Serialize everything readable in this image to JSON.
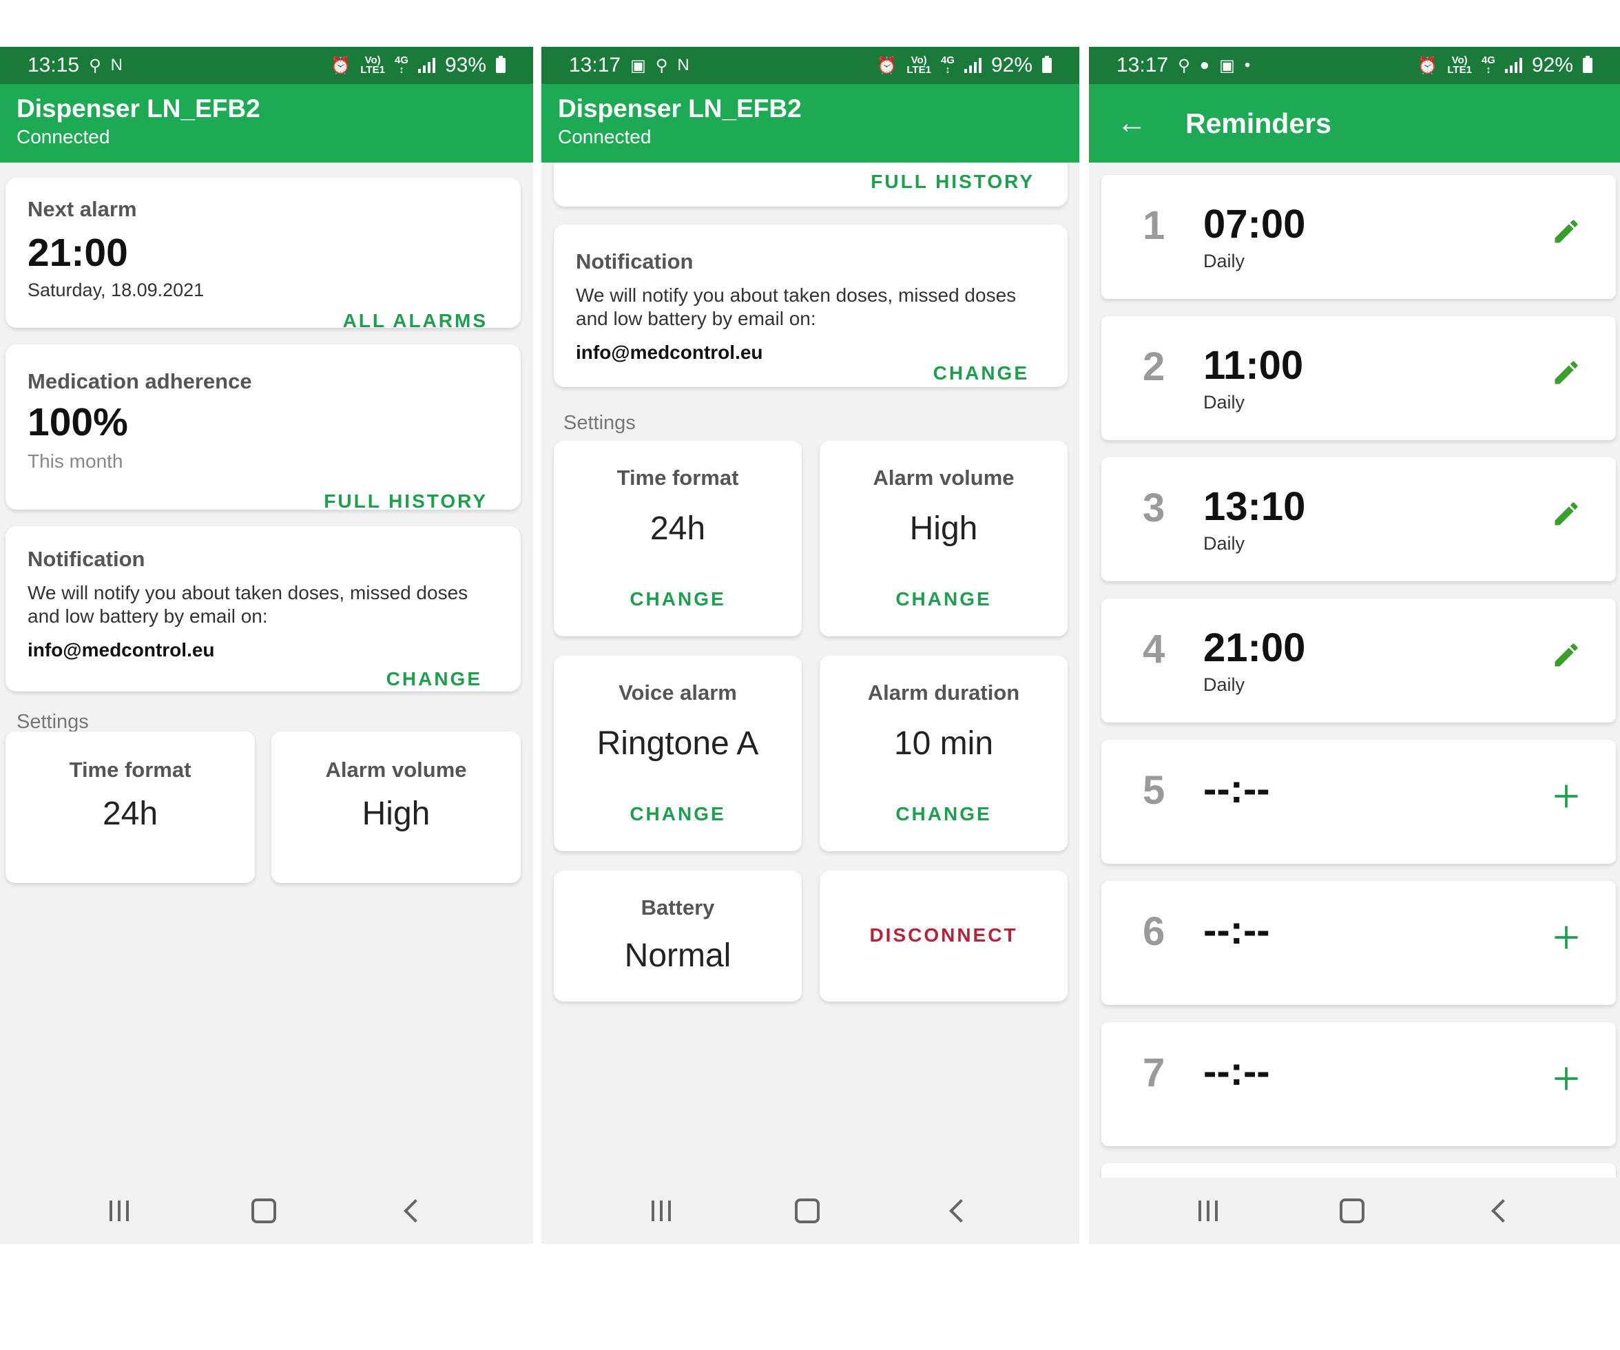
{
  "screens": [
    {
      "status": {
        "time": "13:15",
        "battery": "93%"
      },
      "appbar": {
        "title": "Dispenser LN_EFB2",
        "subtitle": "Connected"
      },
      "next_alarm": {
        "label": "Next alarm",
        "time": "21:00",
        "date": "Saturday, 18.09.2021",
        "action": "ALL ALARMS"
      },
      "adherence": {
        "label": "Medication adherence",
        "value": "100%",
        "period": "This month",
        "action": "FULL HISTORY"
      },
      "notification": {
        "label": "Notification",
        "text": "We will notify you about taken doses, missed doses and low battery by email on:",
        "email": "info@medcontrol.eu",
        "action": "CHANGE"
      },
      "settings_label": "Settings",
      "tiles": [
        {
          "label": "Time format",
          "value": "24h"
        },
        {
          "label": "Alarm volume",
          "value": "High"
        }
      ]
    },
    {
      "status": {
        "time": "13:17",
        "battery": "92%"
      },
      "appbar": {
        "title": "Dispenser LN_EFB2",
        "subtitle": "Connected"
      },
      "top_action": "FULL HISTORY",
      "notification": {
        "label": "Notification",
        "text": "We will notify you about taken doses, missed doses and low battery by email on:",
        "email": "info@medcontrol.eu",
        "action": "CHANGE"
      },
      "settings_label": "Settings",
      "tiles": [
        {
          "label": "Time format",
          "value": "24h",
          "action": "CHANGE"
        },
        {
          "label": "Alarm volume",
          "value": "High",
          "action": "CHANGE"
        },
        {
          "label": "Voice alarm",
          "value": "Ringtone A",
          "action": "CHANGE"
        },
        {
          "label": "Alarm duration",
          "value": "10 min",
          "action": "CHANGE"
        },
        {
          "label": "Battery",
          "value": "Normal"
        }
      ],
      "disconnect": "DISCONNECT"
    },
    {
      "status": {
        "time": "13:17",
        "battery": "92%"
      },
      "appbar": {
        "title": "Reminders"
      },
      "reminders": [
        {
          "num": "1",
          "time": "07:00",
          "repeat": "Daily",
          "icon": "edit-icon"
        },
        {
          "num": "2",
          "time": "11:00",
          "repeat": "Daily",
          "icon": "edit-icon"
        },
        {
          "num": "3",
          "time": "13:10",
          "repeat": "Daily",
          "icon": "edit-icon"
        },
        {
          "num": "4",
          "time": "21:00",
          "repeat": "Daily",
          "icon": "edit-icon"
        },
        {
          "num": "5",
          "time": "--:--",
          "repeat": "",
          "icon": "add-icon"
        },
        {
          "num": "6",
          "time": "--:--",
          "repeat": "",
          "icon": "add-icon"
        },
        {
          "num": "7",
          "time": "--:--",
          "repeat": "",
          "icon": "add-icon"
        }
      ]
    }
  ],
  "colors": {
    "status_bar": "#1a7a3a",
    "app_bar": "#1ea954",
    "accent": "#1e9e4e",
    "danger": "#b3243a"
  }
}
